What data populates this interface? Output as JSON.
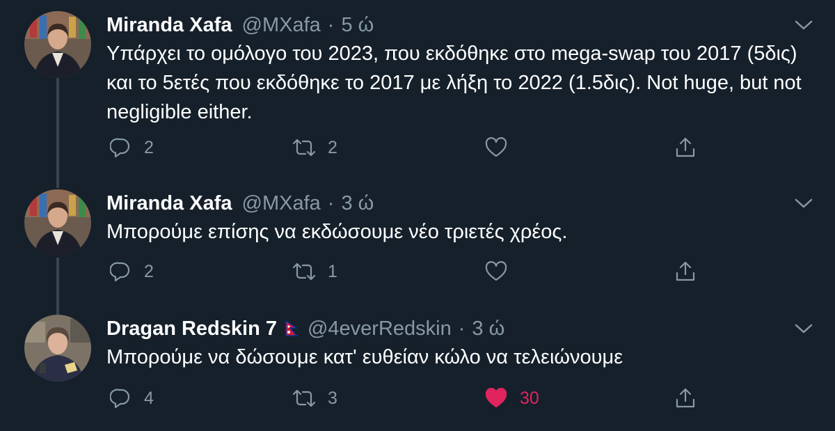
{
  "colors": {
    "background": "#15202b",
    "text_primary": "#ffffff",
    "text_secondary": "#8899a6",
    "thread_line": "#38444d",
    "like_active": "#e0245e"
  },
  "tweets": [
    {
      "name": "Miranda Xafa",
      "handle": "@MXafa",
      "separator": "·",
      "time": "5 ώ",
      "text": "Υπάρχει το ομόλογο του 2023, που εκδόθηκε στο mega-swap του 2017 (5δις) και το 5ετές που εκδόθηκε το 2017 με λήξη το 2022 (1.5δις). Not huge, but not negligible either.",
      "replies": "2",
      "retweets": "2",
      "likes": "",
      "liked": false,
      "avatar_icon": "avatar-photo"
    },
    {
      "name": "Miranda Xafa",
      "handle": "@MXafa",
      "separator": "·",
      "time": "3 ώ",
      "text": "Μπορούμε επίσης να εκδώσουμε νέο τριετές χρέος.",
      "replies": "2",
      "retweets": "1",
      "likes": "",
      "liked": false,
      "avatar_icon": "avatar-photo"
    },
    {
      "name": "Dragan Redskin 7",
      "flag_icon": "nepal-flag-icon",
      "handle": "@4everRedskin",
      "separator": "·",
      "time": "3 ώ",
      "text": "Μπορούμε να δώσουμε κατ' ευθείαν κώλο να τελειώνουμε",
      "replies": "4",
      "retweets": "3",
      "likes": "30",
      "liked": true,
      "avatar_icon": "avatar-photo"
    }
  ],
  "icons": {
    "reply": "reply-icon",
    "retweet": "retweet-icon",
    "like": "heart-icon",
    "share": "share-icon",
    "caret": "chevron-down-icon"
  }
}
